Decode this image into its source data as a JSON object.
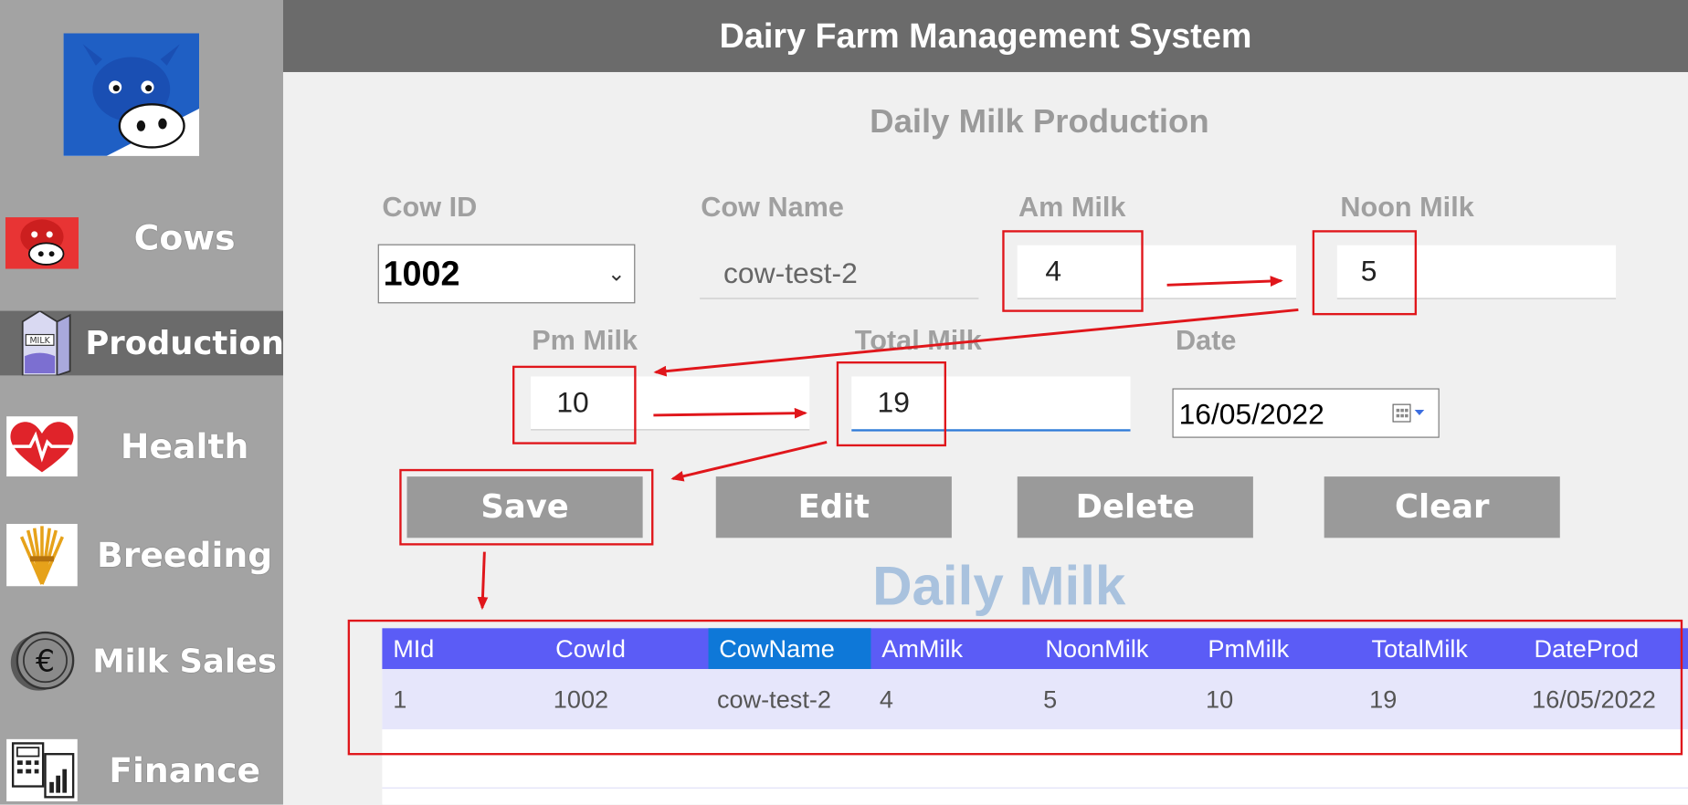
{
  "app": {
    "title": "Dairy Farm Management System"
  },
  "sidebar": {
    "items": [
      {
        "label": "Cows",
        "icon": "cow-icon"
      },
      {
        "label": "Production",
        "icon": "milk-carton-icon",
        "active": true
      },
      {
        "label": "Health",
        "icon": "heart-pulse-icon"
      },
      {
        "label": "Breeding",
        "icon": "hay-icon"
      },
      {
        "label": "Milk Sales",
        "icon": "euro-coin-icon"
      },
      {
        "label": "Finance",
        "icon": "calculator-chart-icon"
      }
    ]
  },
  "form": {
    "title": "Daily Milk Production",
    "cow_id": {
      "label": "Cow ID",
      "value": "1002"
    },
    "cow_name": {
      "label": "Cow Name",
      "value": "cow-test-2"
    },
    "am_milk": {
      "label": "Am Milk",
      "value": "4"
    },
    "noon_milk": {
      "label": "Noon Milk",
      "value": "5"
    },
    "pm_milk": {
      "label": "Pm Milk",
      "value": "10"
    },
    "total_milk": {
      "label": "Total Milk",
      "value": "19"
    },
    "date": {
      "label": "Date",
      "value": "16/05/2022"
    }
  },
  "buttons": {
    "save": "Save",
    "edit": "Edit",
    "delete": "Delete",
    "clear": "Clear"
  },
  "grid": {
    "title": "Daily Milk",
    "columns": [
      "MId",
      "CowId",
      "CowName",
      "AmMilk",
      "NoonMilk",
      "PmMilk",
      "TotalMilk",
      "DateProd"
    ],
    "selected_column": "CowName",
    "rows": [
      [
        "1",
        "1002",
        "cow-test-2",
        "4",
        "5",
        "10",
        "19",
        "16/05/2022"
      ]
    ]
  },
  "colors": {
    "sidebar_bg": "#a3a3a3",
    "header_bg": "#6b6b6b",
    "button_bg": "#9a9a9a",
    "grid_header": "#5b5cf6",
    "grid_selected_header": "#0e78d8",
    "grid_row": "#e6e6fb",
    "annotation_red": "#e0161b"
  }
}
